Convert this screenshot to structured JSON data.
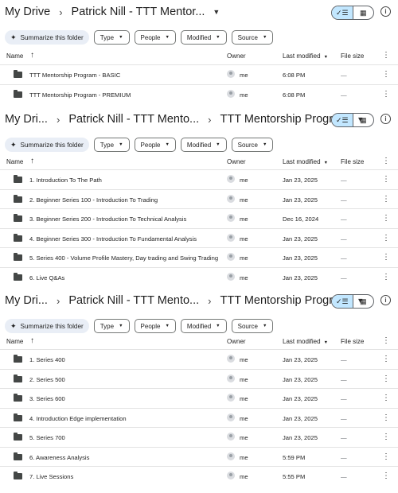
{
  "panels": [
    {
      "breadcrumb": [
        "My Drive",
        "Patrick Nill - TTT Mentor..."
      ],
      "toolbar": {
        "summarize": "Summarize this folder",
        "filters": [
          "Type",
          "People",
          "Modified",
          "Source"
        ]
      },
      "headers": {
        "name": "Name",
        "owner": "Owner",
        "modified": "Last modified",
        "size": "File size"
      },
      "rows": [
        {
          "name": "TTT Mentorship Program - BASIC",
          "owner": "me",
          "modified": "6:08 PM",
          "size": "—"
        },
        {
          "name": "TTT Mentorship Program - PREMIUM",
          "owner": "me",
          "modified": "6:08 PM",
          "size": "—"
        }
      ]
    },
    {
      "breadcrumb": [
        "My Dri...",
        "Patrick Nill - TTT Mento...",
        "TTT Mentorship Progra..."
      ],
      "toolbar": {
        "summarize": "Summarize this folder",
        "filters": [
          "Type",
          "People",
          "Modified",
          "Source"
        ]
      },
      "headers": {
        "name": "Name",
        "owner": "Owner",
        "modified": "Last modified",
        "size": "File size"
      },
      "rows": [
        {
          "name": "1. Introduction To The Path",
          "owner": "me",
          "modified": "Jan 23, 2025",
          "size": "—"
        },
        {
          "name": "2. Beginner Series 100 - Introduction To Trading",
          "owner": "me",
          "modified": "Jan 23, 2025",
          "size": "—"
        },
        {
          "name": "3. Beginner Series 200 - Introduction To Technical Analysis",
          "owner": "me",
          "modified": "Dec 16, 2024",
          "size": "—"
        },
        {
          "name": "4. Beginner Series 300 - Introduction To Fundamental Analysis",
          "owner": "me",
          "modified": "Jan 23, 2025",
          "size": "—"
        },
        {
          "name": "5. Series 400 - Volume Profile Mastery, Day trading and Swing Trading",
          "owner": "me",
          "modified": "Jan 23, 2025",
          "size": "—"
        },
        {
          "name": "6. Live Q&As",
          "owner": "me",
          "modified": "Jan 23, 2025",
          "size": "—"
        }
      ]
    },
    {
      "breadcrumb": [
        "My Dri...",
        "Patrick Nill - TTT Mento...",
        "TTT Mentorship Progra..."
      ],
      "toolbar": {
        "summarize": "Summarize this folder",
        "filters": [
          "Type",
          "People",
          "Modified",
          "Source"
        ]
      },
      "headers": {
        "name": "Name",
        "owner": "Owner",
        "modified": "Last modified",
        "size": "File size"
      },
      "rows": [
        {
          "name": "1. Series 400",
          "owner": "me",
          "modified": "Jan 23, 2025",
          "size": "—"
        },
        {
          "name": "2. Series 500",
          "owner": "me",
          "modified": "Jan 23, 2025",
          "size": "—"
        },
        {
          "name": "3. Series 600",
          "owner": "me",
          "modified": "Jan 23, 2025",
          "size": "—"
        },
        {
          "name": "4. Introduction Edge implementation",
          "owner": "me",
          "modified": "Jan 23, 2025",
          "size": "—"
        },
        {
          "name": "5. Series 700",
          "owner": "me",
          "modified": "Jan 23, 2025",
          "size": "—"
        },
        {
          "name": "6. Awareness Analysis",
          "owner": "me",
          "modified": "5:59 PM",
          "size": "—"
        },
        {
          "name": "7. Live Sessions",
          "owner": "me",
          "modified": "5:55 PM",
          "size": "—"
        }
      ]
    }
  ],
  "icons": {
    "folder": "folder-icon",
    "avatar": "avatar-icon",
    "spark": "sparkle-icon",
    "list_view": "list-view-icon",
    "grid_view": "grid-view-icon",
    "info": "info-icon",
    "more": "more-vert-icon"
  },
  "colors": {
    "toggle_active": "#c2e7ff",
    "chip_bg": "#e9eef6",
    "folder": "#444746"
  }
}
